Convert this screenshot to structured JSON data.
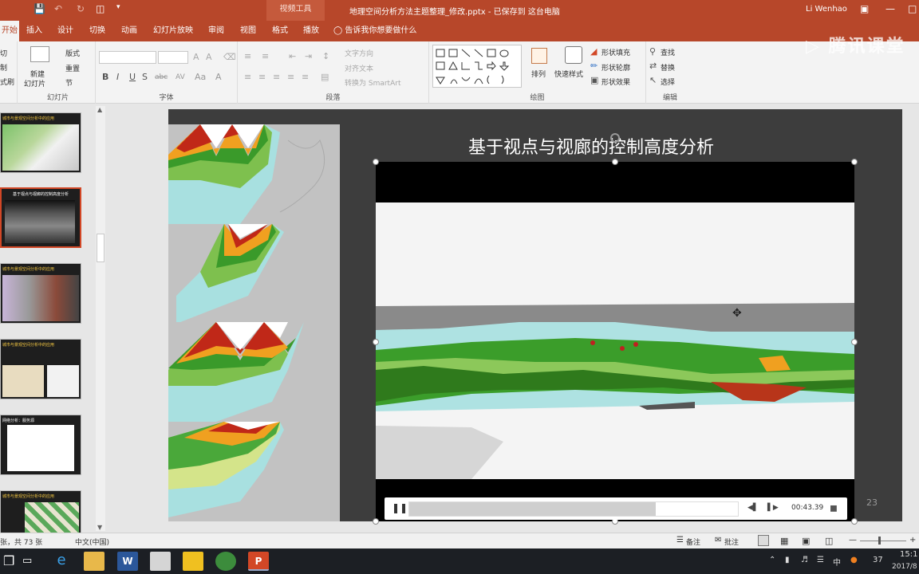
{
  "titlebar": {
    "context_header": "视频工具",
    "document_title": "地理空间分析方法主题整理_修改.pptx  -  已保存到 这台电脑",
    "user_name": "Li Wenhao"
  },
  "tabs": [
    "开始",
    "插入",
    "设计",
    "切换",
    "动画",
    "幻灯片放映",
    "审阅",
    "视图",
    "格式",
    "播放"
  ],
  "tell_me": "告诉我你想要做什么",
  "ribbon": {
    "clipboard": {
      "cut": "切",
      "copy": "制",
      "format_painter": "式刷"
    },
    "slides": {
      "new_slide": "新建",
      "new_slide_2": "幻灯片",
      "layout": "版式",
      "reset": "重置",
      "section": "节",
      "label": "幻灯片"
    },
    "font": {
      "label": "字体",
      "bold": "B",
      "italic": "I",
      "underline": "U",
      "strike": "S",
      "spacing": "abc",
      "case": "AV"
    },
    "paragraph": {
      "label": "段落",
      "text_direction": "文字方向",
      "align_text": "对齐文本",
      "smartart": "转换为 SmartArt"
    },
    "drawing": {
      "label": "绘图",
      "arrange": "排列",
      "quick_styles": "快速样式",
      "shape_fill": "形状填充",
      "shape_outline": "形状轮廓",
      "shape_effects": "形状效果"
    },
    "editing": {
      "label": "编辑",
      "find": "查找",
      "replace": "替换",
      "select": "选择"
    }
  },
  "thumbnails": [
    {
      "title": "城市与景观空间分析中的应用"
    },
    {
      "title": "基于视点与视廊的控制高度分析"
    },
    {
      "title": "城市与景观空间分析中的应用"
    },
    {
      "title": "城市与景观空间分析中的应用"
    },
    {
      "title": "网络分析：服务源"
    },
    {
      "title": "城市与景观空间分析中的应用"
    }
  ],
  "slide": {
    "title": "基于视点与视廊的控制高度分析",
    "number": "23"
  },
  "video": {
    "time": "00:43.39",
    "progress": 0.75
  },
  "statusbar": {
    "slide_count": "张，共 73 张",
    "language": "中文(中国)",
    "notes": "备注",
    "comments": "批注"
  },
  "tray": {
    "ime": "中",
    "temp": "37",
    "time": "15:1",
    "date": "2017/8"
  },
  "watermark": "腾讯课堂",
  "colors": {
    "accent": "#b7472a",
    "selection": "#d24726"
  }
}
